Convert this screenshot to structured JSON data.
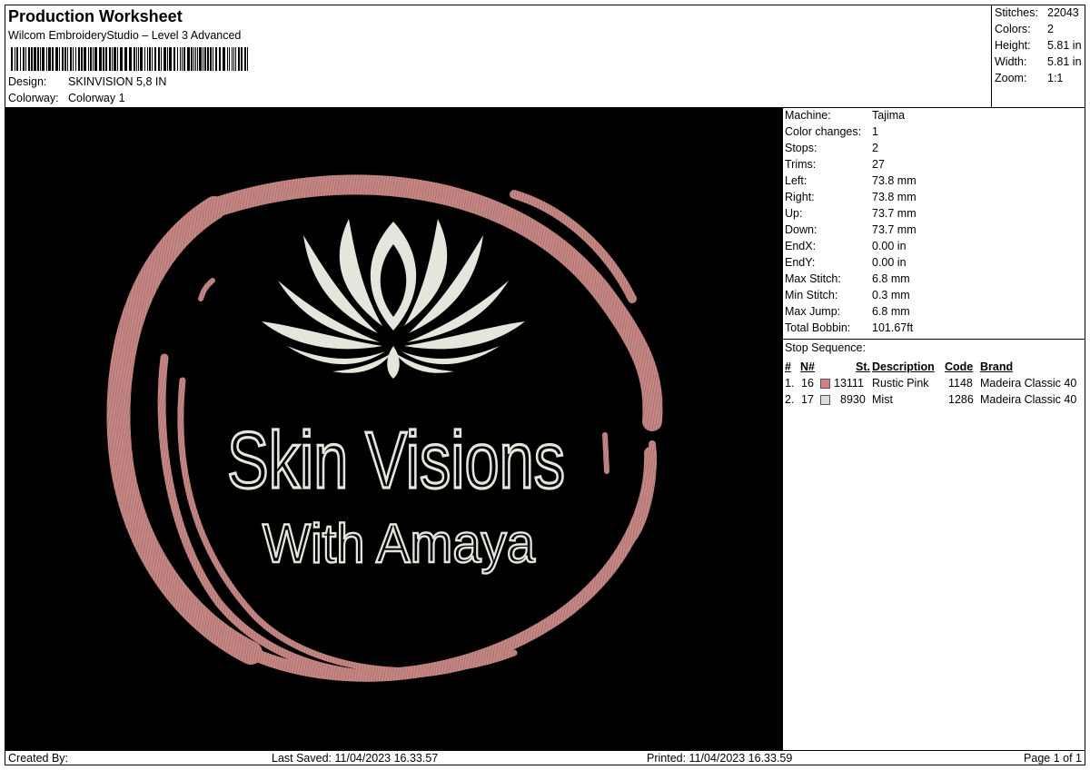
{
  "header": {
    "title": "Production Worksheet",
    "subtitle": "Wilcom EmbroideryStudio – Level 3 Advanced",
    "design_label": "Design:",
    "design_value": "SKINVISION 5,8 IN",
    "colorway_label": "Colorway:",
    "colorway_value": "Colorway 1"
  },
  "stats": {
    "stitches_label": "Stitches:",
    "stitches": "22043",
    "colors_label": "Colors:",
    "colors": "2",
    "height_label": "Height:",
    "height": "5.81 in",
    "width_label": "Width:",
    "width": "5.81 in",
    "zoom_label": "Zoom:",
    "zoom": "1:1"
  },
  "machine": {
    "machine_label": "Machine:",
    "machine": "Tajima",
    "color_changes_label": "Color changes:",
    "color_changes": "1",
    "stops_label": "Stops:",
    "stops": "2",
    "trims_label": "Trims:",
    "trims": "27",
    "left_label": "Left:",
    "left": "73.8 mm",
    "right_label": "Right:",
    "right": "73.8 mm",
    "up_label": "Up:",
    "up": "73.7 mm",
    "down_label": "Down:",
    "down": "73.7 mm",
    "endx_label": "EndX:",
    "endx": "0.00 in",
    "endy_label": "EndY:",
    "endy": "0.00 in",
    "max_stitch_label": "Max Stitch:",
    "max_stitch": "6.8 mm",
    "min_stitch_label": "Min Stitch:",
    "min_stitch": "0.3 mm",
    "max_jump_label": "Max Jump:",
    "max_jump": "6.8 mm",
    "total_bobbin_label": "Total Bobbin:",
    "total_bobbin": "101.67ft"
  },
  "stop_sequence": {
    "title": "Stop Sequence:",
    "headers": {
      "hash": "#",
      "n": "N#",
      "st": "St.",
      "description": "Description",
      "code": "Code",
      "brand": "Brand"
    },
    "rows": [
      {
        "index": "1.",
        "n": "16",
        "color": "#d87d84",
        "st": "13111",
        "description": "Rustic Pink",
        "code": "1148",
        "brand": "Madeira Classic 40"
      },
      {
        "index": "2.",
        "n": "17",
        "color": "#dcdcdc",
        "st": "8930",
        "description": "Mist",
        "code": "1286",
        "brand": "Madeira Classic 40"
      }
    ]
  },
  "design_art": {
    "line1": "Skin Visions",
    "line2": "With Amaya",
    "thread_pink": "#c98a86",
    "thread_mist": "#e4e6dc"
  },
  "footer": {
    "created_by": "Created By:",
    "last_saved": "Last Saved: 11/04/2023 16.33.57",
    "printed": "Printed: 11/04/2023 16.33.59",
    "page": "Page 1 of 1"
  }
}
